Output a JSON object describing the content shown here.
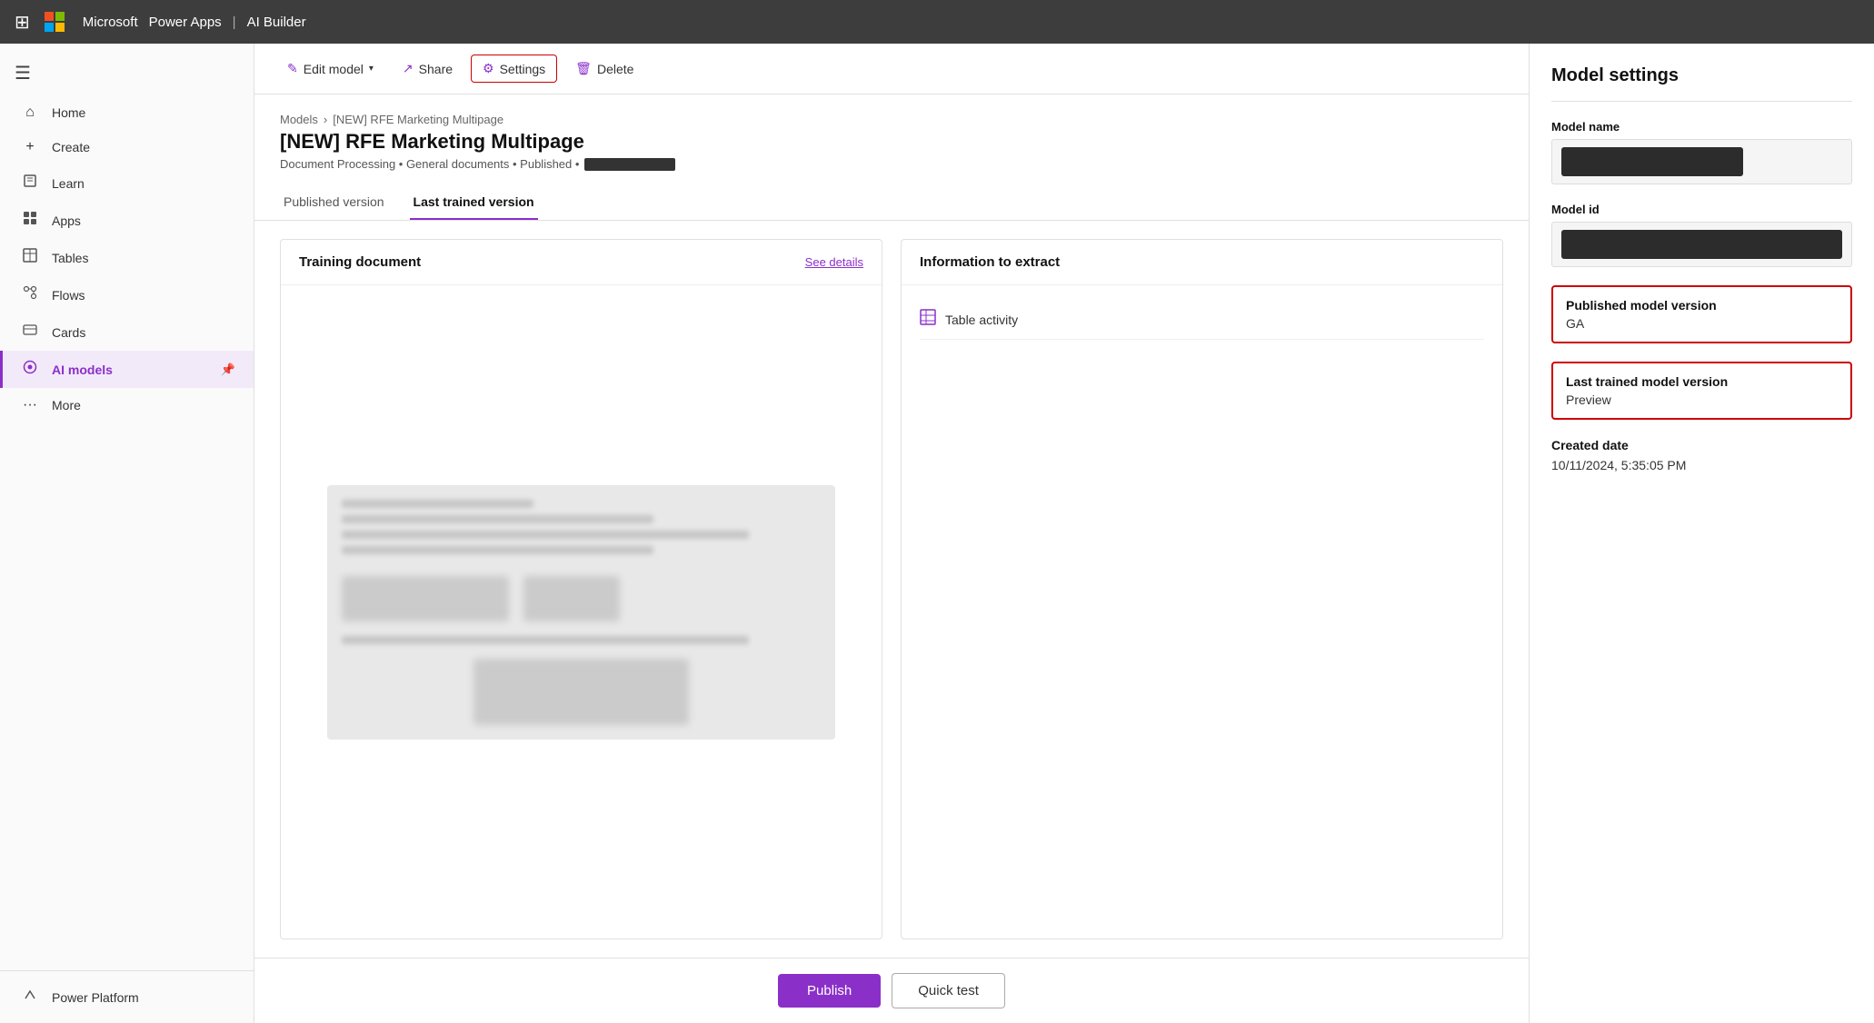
{
  "topbar": {
    "waffle_label": "⊞",
    "ms_label": "Microsoft",
    "app_title": "Power Apps",
    "separator": "|",
    "product_title": "AI Builder"
  },
  "sidebar": {
    "toggle_icon": "☰",
    "items": [
      {
        "id": "home",
        "label": "Home",
        "icon": "⌂"
      },
      {
        "id": "create",
        "label": "Create",
        "icon": "+"
      },
      {
        "id": "learn",
        "label": "Learn",
        "icon": "□"
      },
      {
        "id": "apps",
        "label": "Apps",
        "icon": "⊞"
      },
      {
        "id": "tables",
        "label": "Tables",
        "icon": "▦"
      },
      {
        "id": "flows",
        "label": "Flows",
        "icon": "⟳"
      },
      {
        "id": "cards",
        "label": "Cards",
        "icon": "▣"
      },
      {
        "id": "ai-models",
        "label": "AI models",
        "icon": "◎",
        "active": true
      },
      {
        "id": "more",
        "label": "More",
        "icon": "···"
      }
    ],
    "bottom_item": {
      "id": "power-platform",
      "label": "Power Platform",
      "icon": "⚡"
    }
  },
  "toolbar": {
    "edit_model_label": "Edit model",
    "edit_model_icon": "✎",
    "share_label": "Share",
    "share_icon": "↗",
    "settings_label": "Settings",
    "settings_icon": "⚙",
    "delete_label": "Delete",
    "delete_icon": "🗑"
  },
  "breadcrumb": {
    "parent_label": "Models",
    "separator": "›",
    "current_label": "[NEW] RFE Marketing Multipage"
  },
  "page_header": {
    "title": "[NEW] RFE Marketing Multipage",
    "meta": "Document Processing • General documents • Published •"
  },
  "tabs": [
    {
      "id": "published-version",
      "label": "Published version"
    },
    {
      "id": "last-trained-version",
      "label": "Last trained version",
      "active": true
    }
  ],
  "training_card": {
    "title": "Training document",
    "link_label": "See details"
  },
  "info_card": {
    "title": "Information to extract",
    "items": [
      {
        "icon": "▦",
        "label": "Table activity"
      }
    ]
  },
  "actions": {
    "publish_label": "Publish",
    "quick_test_label": "Quick test"
  },
  "settings_panel": {
    "title": "Model settings",
    "model_name_label": "Model name",
    "model_id_label": "Model id",
    "published_version_label": "Published model version",
    "published_version_value": "GA",
    "last_trained_version_label": "Last trained model version",
    "last_trained_version_value": "Preview",
    "created_date_label": "Created date",
    "created_date_value": "10/11/2024, 5:35:05 PM"
  }
}
